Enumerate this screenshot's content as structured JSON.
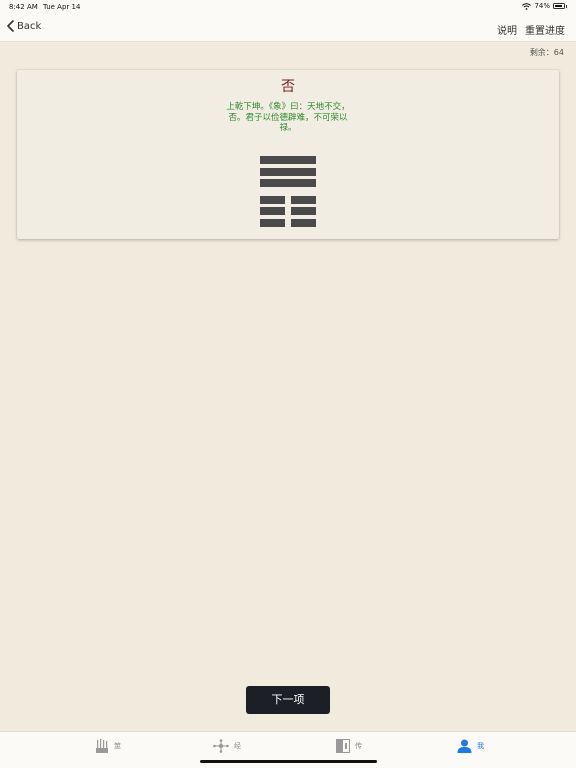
{
  "status_bar": {
    "time": "8:42 AM",
    "date": "Tue Apr 14",
    "battery": "74%",
    "battery_level": 0.74,
    "icons": [
      "wifi-icon",
      "battery-icon"
    ]
  },
  "nav": {
    "back_label": "Back",
    "actions": [
      "说明",
      "重置进度"
    ]
  },
  "remaining": "剩余：64",
  "card": {
    "name": "否",
    "text": "上乾下坤。《象》曰：天地不交，否。君子以俭德辟难，不可荣以禄。",
    "lines": [
      "yang",
      "yang",
      "yang",
      "yin",
      "yin",
      "yin"
    ]
  },
  "next_button": "下一项",
  "tabs": [
    {
      "label": "筮",
      "icon": "yarrow-stalks-icon",
      "active": false
    },
    {
      "label": "经",
      "icon": "network-icon",
      "active": false
    },
    {
      "label": "传",
      "icon": "book-icon",
      "active": false
    },
    {
      "label": "我",
      "icon": "person-icon",
      "active": true
    }
  ],
  "colors": {
    "background": "#f1ebde",
    "hex_name": "#7a2222",
    "hex_text": "#2e8b2e",
    "active_tab": "#1b7ae8",
    "button": "#1c1f26"
  }
}
